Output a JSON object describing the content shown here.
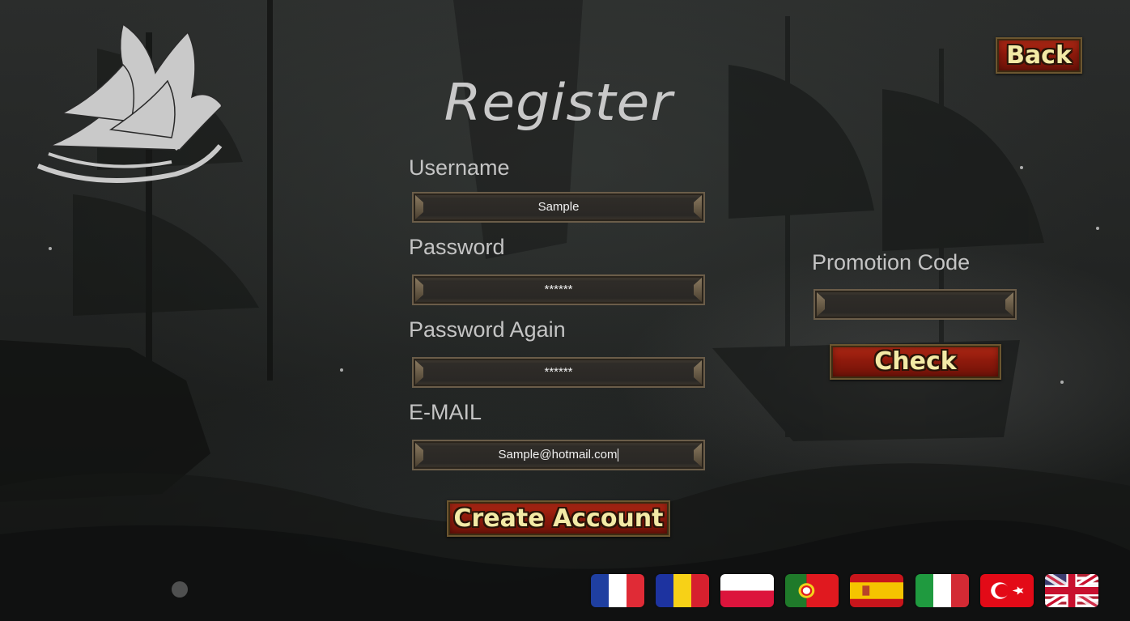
{
  "header": {
    "title": "Register",
    "back_label": "Back"
  },
  "form": {
    "username": {
      "label": "Username",
      "value": "Sample"
    },
    "password": {
      "label": "Password",
      "value": "******"
    },
    "password_again": {
      "label": "Password Again",
      "value": "******"
    },
    "email": {
      "label": "E-MAIL",
      "value": "Sample@hotmail.com"
    },
    "create_label": "Create Account"
  },
  "promotion": {
    "label": "Promotion Code",
    "value": "",
    "check_label": "Check"
  },
  "languages": [
    "french-flag-icon",
    "romanian-flag-icon",
    "polish-flag-icon",
    "portuguese-flag-icon",
    "spanish-flag-icon",
    "italian-flag-icon",
    "turkish-flag-icon",
    "english-flag-icon"
  ],
  "colors": {
    "button_red": "#8f1a0c",
    "button_text": "#f3eaa6",
    "label_gray": "#c4c4c4"
  }
}
